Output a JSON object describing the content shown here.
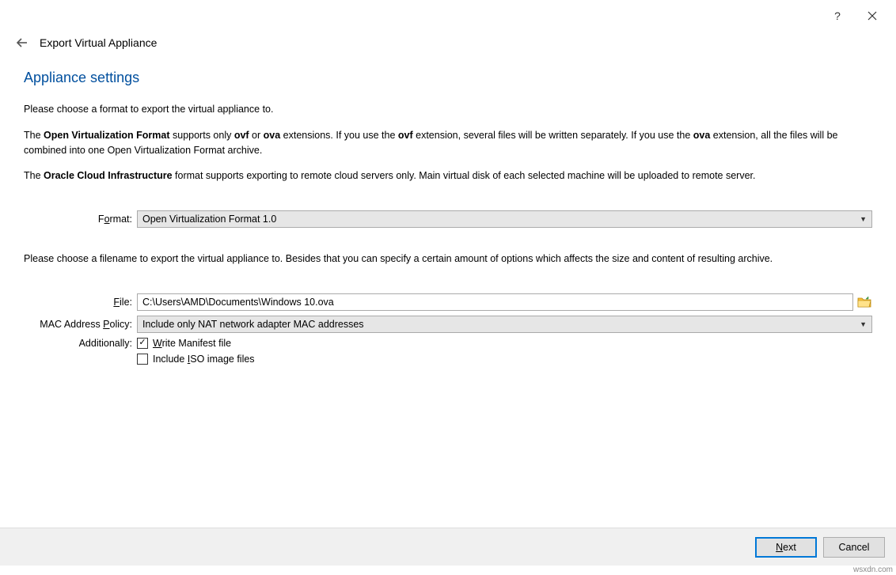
{
  "window": {
    "title": "Export Virtual Appliance"
  },
  "heading": "Appliance settings",
  "paragraphs": {
    "p1": "Please choose a format to export the virtual appliance to.",
    "p2_pre": "The ",
    "p2_b1": "Open Virtualization Format",
    "p2_mid1": " supports only ",
    "p2_b2": "ovf",
    "p2_mid2": " or ",
    "p2_b3": "ova",
    "p2_mid3": " extensions. If you use the ",
    "p2_b4": "ovf",
    "p2_mid4": " extension, several files will be written separately. If you use the ",
    "p2_b5": "ova",
    "p2_post": " extension, all the files will be combined into one Open Virtualization Format archive.",
    "p3_pre": "The ",
    "p3_b1": "Oracle Cloud Infrastructure",
    "p3_post": " format supports exporting to remote cloud servers only. Main virtual disk of each selected machine will be uploaded to remote server.",
    "p4": "Please choose a filename to export the virtual appliance to. Besides that you can specify a certain amount of options which affects the size and content of resulting archive."
  },
  "form": {
    "format_label_pre": "F",
    "format_label_ul": "o",
    "format_label_post": "rmat:",
    "format_value": "Open Virtualization Format 1.0",
    "file_label_ul": "F",
    "file_label_post": "ile:",
    "file_value": "C:\\Users\\AMD\\Documents\\Windows 10.ova",
    "mac_label_pre": "MAC Address ",
    "mac_label_ul": "P",
    "mac_label_post": "olicy:",
    "mac_value": "Include only NAT network adapter MAC addresses",
    "additionally_label": "Additionally:",
    "cb1_ul": "W",
    "cb1_post": "rite Manifest file",
    "cb1_checked": true,
    "cb2_pre": "Include ",
    "cb2_ul": "I",
    "cb2_post": "SO image files",
    "cb2_checked": false
  },
  "footer": {
    "next_ul": "N",
    "next_post": "ext",
    "cancel": "Cancel"
  },
  "watermark": "wsxdn.com"
}
